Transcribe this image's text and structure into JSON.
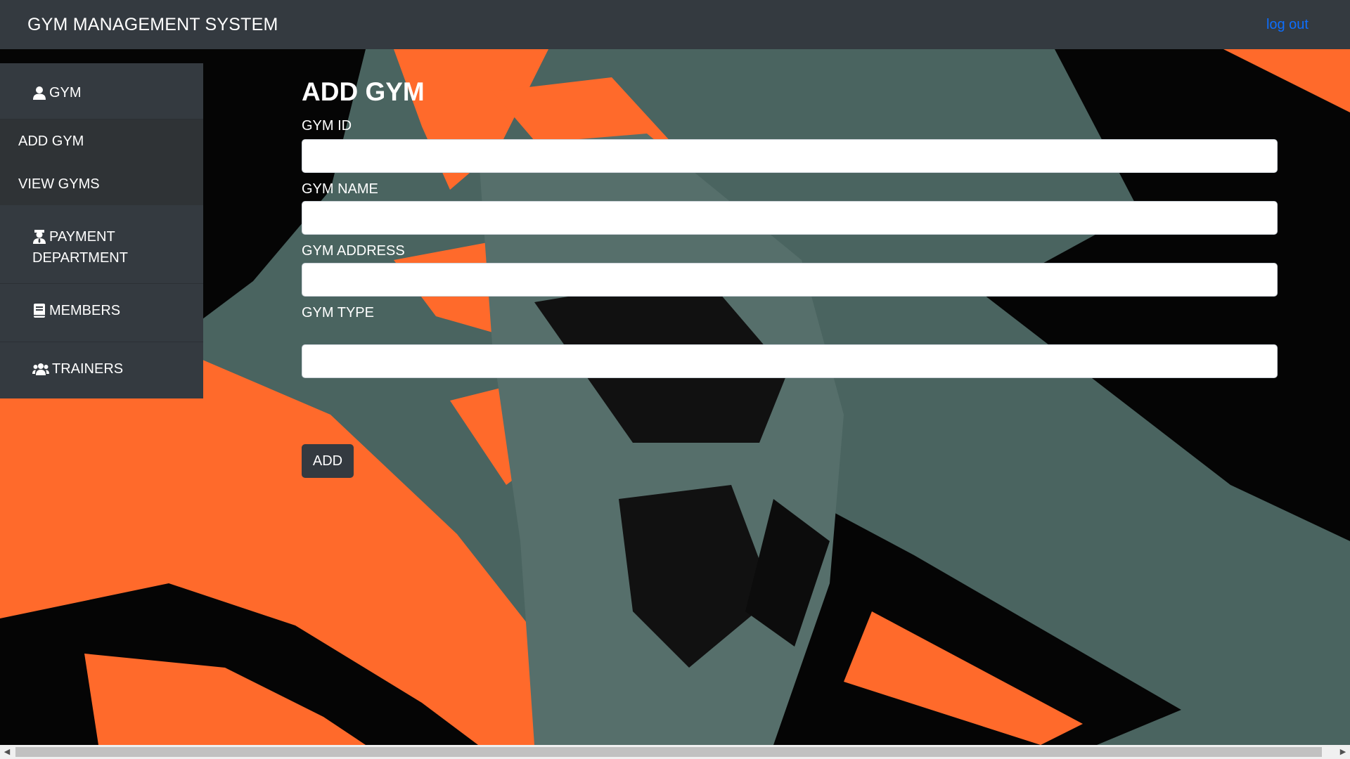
{
  "app": {
    "title": "GYM MANAGEMENT SYSTEM",
    "logout_label": "log out"
  },
  "sidebar": {
    "gym_label": "GYM",
    "gym_icon": "user-icon",
    "submenu": [
      "ADD GYM",
      "VIEW GYMS"
    ],
    "payment_line1": "PAYMENT",
    "payment_line2": "DEPARTMENT",
    "payment_icon": "user-tie-icon",
    "members_label": "MEMBERS",
    "members_icon": "book-icon",
    "trainers_label": "TRAINERS",
    "trainers_icon": "users-icon"
  },
  "form": {
    "title": "ADD GYM",
    "gym_id_label": "GYM ID",
    "gym_id_value": "",
    "gym_name_label": "GYM NAME",
    "gym_name_value": "",
    "gym_address_label": "GYM ADDRESS",
    "gym_address_value": "",
    "gym_type_label": "GYM TYPE",
    "gym_type_value": "",
    "submit_label": "ADD"
  },
  "colors": {
    "navbar": "#343a40",
    "link": "#0d6efd",
    "background_teal": "#4a6460",
    "background_orange": "#ff6a2b",
    "background_black": "#000000"
  }
}
